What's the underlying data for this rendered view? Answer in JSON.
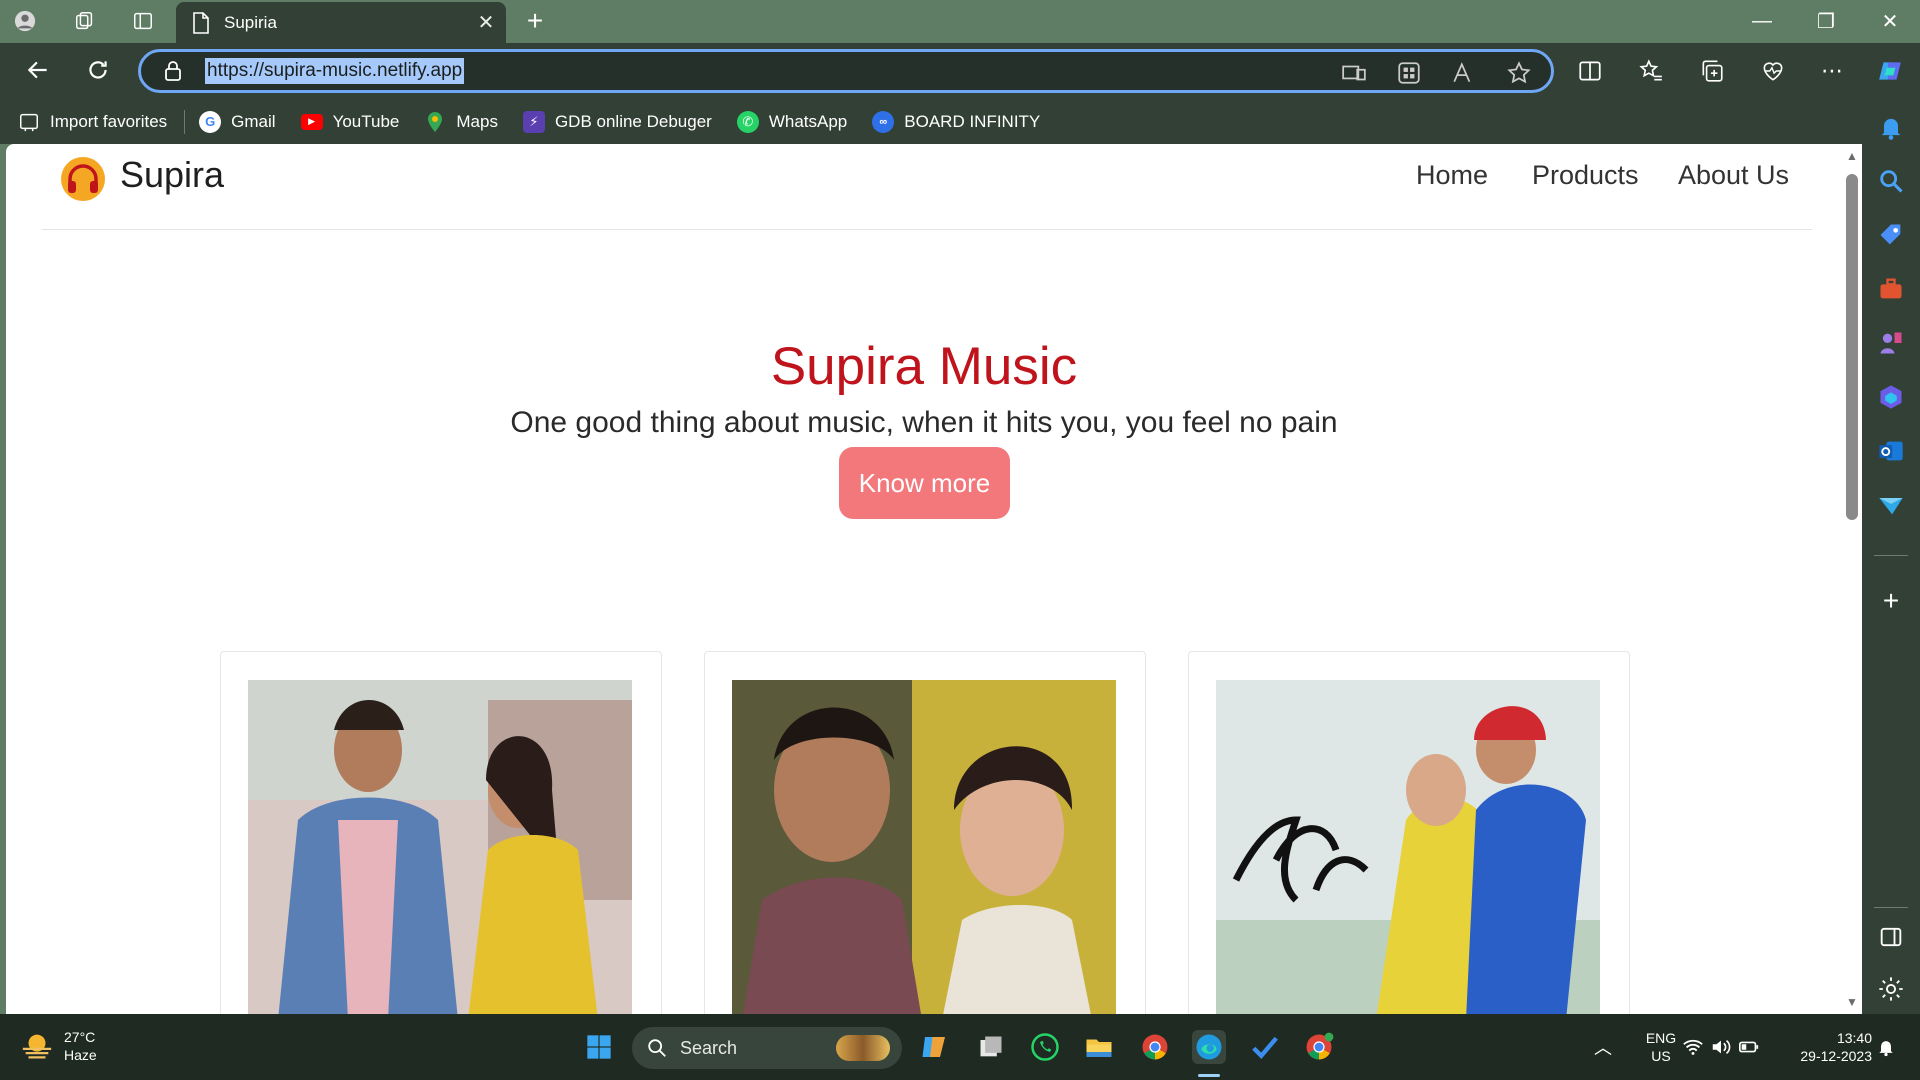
{
  "browser": {
    "tab_title": "Supiria",
    "url": "https://supira-music.netlify.app",
    "favorites": [
      {
        "label": "Import favorites",
        "icon": "import-favorites-icon"
      },
      {
        "label": "Gmail",
        "icon": "google-icon"
      },
      {
        "label": "YouTube",
        "icon": "youtube-icon"
      },
      {
        "label": "Maps",
        "icon": "maps-icon"
      },
      {
        "label": "GDB online Debuger",
        "icon": "gdb-icon"
      },
      {
        "label": "WhatsApp",
        "icon": "whatsapp-icon"
      },
      {
        "label": "BOARD INFINITY",
        "icon": "board-infinity-icon"
      }
    ]
  },
  "site": {
    "brand": "Supira",
    "nav": [
      "Home",
      "Products",
      "About Us"
    ],
    "hero": {
      "title": "Supira Music",
      "subtitle": "One good thing about music, when it hits you, you feel no pain",
      "button": "Know more"
    }
  },
  "taskbar": {
    "weather_temp": "27°C",
    "weather_desc": "Haze",
    "search_label": "Search",
    "lang_top": "ENG",
    "lang_bottom": "US",
    "time": "13:40",
    "date": "29-12-2023"
  },
  "colors": {
    "frame": "#5f7d64",
    "chrome_dark": "#324036",
    "hero_title": "#c0141c",
    "button": "#f2787c",
    "url_border": "#6fa7f4"
  }
}
